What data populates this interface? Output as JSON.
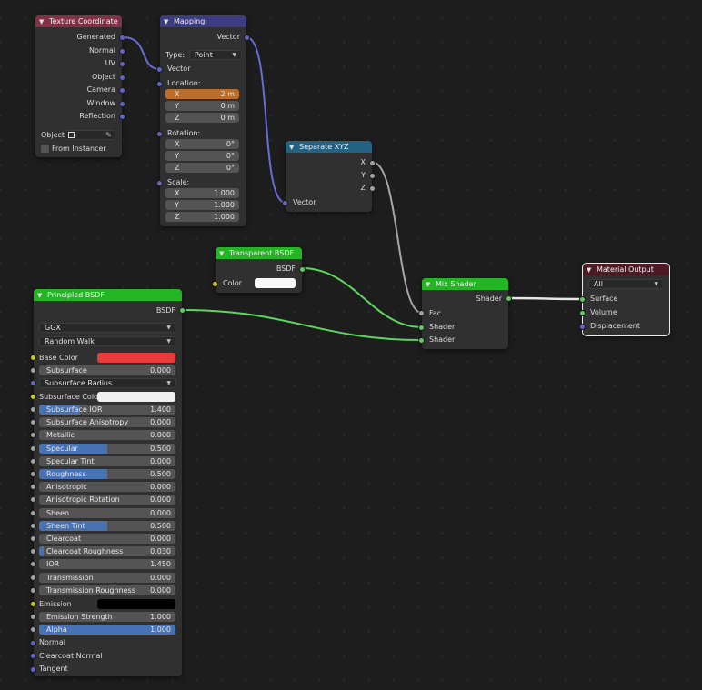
{
  "colors": {
    "vector_socket": "#6363c7",
    "shader_socket": "#63c763",
    "color_socket": "#c7c729",
    "float_socket": "#a1a1a1",
    "header_input": "#83314a",
    "header_vector": "#3c3c83",
    "header_converter": "#246283",
    "header_shader": "#24b524",
    "header_output": "#4d1a24",
    "field_fill": "#4772b3",
    "field_highlight": "#bb6e2b",
    "base_color": "#e83b3b",
    "white_color": "#f0f0f0",
    "emission_color": "#000000"
  },
  "icons": {
    "collapse": "chevron-down-icon",
    "dropdown": "dropdown-arrow-icon",
    "eyedropper": "eyedropper-icon",
    "object_type": "object-icon"
  },
  "texture_coordinate": {
    "title": "Texture Coordinate",
    "outputs": [
      "Generated",
      "Normal",
      "UV",
      "Object",
      "Camera",
      "Window",
      "Reflection"
    ],
    "object_label": "Object:",
    "from_instancer": "From Instancer"
  },
  "mapping": {
    "title": "Mapping",
    "output": "Vector",
    "type_label": "Type:",
    "type_value": "Point",
    "input_vector": "Vector",
    "location_label": "Location:",
    "location": [
      {
        "axis": "X",
        "value": "2 m"
      },
      {
        "axis": "Y",
        "value": "0 m"
      },
      {
        "axis": "Z",
        "value": "0 m"
      }
    ],
    "rotation_label": "Rotation:",
    "rotation": [
      {
        "axis": "X",
        "value": "0°"
      },
      {
        "axis": "Y",
        "value": "0°"
      },
      {
        "axis": "Z",
        "value": "0°"
      }
    ],
    "scale_label": "Scale:",
    "scale": [
      {
        "axis": "X",
        "value": "1.000"
      },
      {
        "axis": "Y",
        "value": "1.000"
      },
      {
        "axis": "Z",
        "value": "1.000"
      }
    ]
  },
  "separate_xyz": {
    "title": "Separate XYZ",
    "outputs": [
      "X",
      "Y",
      "Z"
    ],
    "input": "Vector"
  },
  "transparent_bsdf": {
    "title": "Transparent BSDF",
    "output": "BSDF",
    "color_label": "Color"
  },
  "mix_shader": {
    "title": "Mix Shader",
    "output": "Shader",
    "inputs": [
      "Fac",
      "Shader",
      "Shader"
    ]
  },
  "material_output": {
    "title": "Material Output",
    "target": "All",
    "inputs": [
      "Surface",
      "Volume",
      "Displacement"
    ]
  },
  "principled_bsdf": {
    "title": "Principled BSDF",
    "output": "BSDF",
    "distribution": "GGX",
    "subsurface_method": "Random Walk",
    "base_color_label": "Base Color",
    "subsurface": {
      "label": "Subsurface",
      "value": "0.000",
      "fraction": 0
    },
    "subsurface_radius": "Subsurface Radius",
    "subsurface_color_label": "Subsurface Color",
    "sliders": [
      {
        "label": "Subsurface IOR",
        "value": "1.400",
        "fraction": 0.3
      },
      {
        "label": "Subsurface Anisotropy",
        "value": "0.000",
        "fraction": 0
      },
      {
        "label": "Metallic",
        "value": "0.000",
        "fraction": 0
      },
      {
        "label": "Specular",
        "value": "0.500",
        "fraction": 0.5
      },
      {
        "label": "Specular Tint",
        "value": "0.000",
        "fraction": 0
      },
      {
        "label": "Roughness",
        "value": "0.500",
        "fraction": 0.5
      },
      {
        "label": "Anisotropic",
        "value": "0.000",
        "fraction": 0
      },
      {
        "label": "Anisotropic Rotation",
        "value": "0.000",
        "fraction": 0
      },
      {
        "label": "Sheen",
        "value": "0.000",
        "fraction": 0
      },
      {
        "label": "Sheen Tint",
        "value": "0.500",
        "fraction": 0.5
      },
      {
        "label": "Clearcoat",
        "value": "0.000",
        "fraction": 0
      },
      {
        "label": "Clearcoat Roughness",
        "value": "0.030",
        "fraction": 0.03
      },
      {
        "label": "IOR",
        "value": "1.450",
        "fraction": 0
      },
      {
        "label": "Transmission",
        "value": "0.000",
        "fraction": 0
      },
      {
        "label": "Transmission Roughness",
        "value": "0.000",
        "fraction": 0
      }
    ],
    "emission_label": "Emission",
    "emission_strength": {
      "label": "Emission Strength",
      "value": "1.000",
      "fraction": 0
    },
    "alpha": {
      "label": "Alpha",
      "value": "1.000",
      "fraction": 1
    },
    "vector_inputs": [
      "Normal",
      "Clearcoat Normal",
      "Tangent"
    ]
  }
}
